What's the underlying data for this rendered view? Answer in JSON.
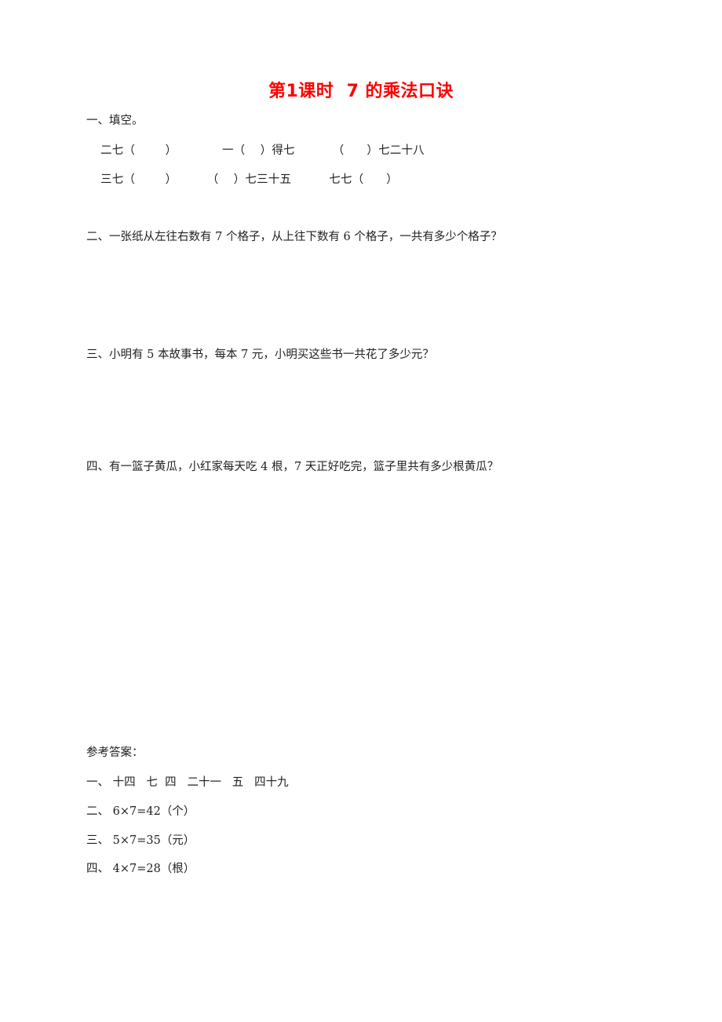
{
  "document": {
    "title": "第1课时  7 的乘法口诀",
    "title_color": "#ff0000"
  },
  "sections": [
    {
      "id": "section-1",
      "heading": "一、填空。",
      "fill_rows": [
        "二七（        ）            一（    ）得七          （      ）七二十八",
        "三七（        ）        （    ）七三十五          七七（      ）"
      ]
    },
    {
      "id": "section-2",
      "text": "二、一张纸从左往右数有 7 个格子，从上往下数有 6 个格子，一共有多少个格子？"
    },
    {
      "id": "section-3",
      "text": "三、小明有 5 本故事书，每本 7 元，小明买这些书一共花了多少元？"
    },
    {
      "id": "section-4",
      "text": "四、有一篮子黄瓜，小红家每天吃 4 根，7 天正好吃完，篮子里共有多少根黄瓜？"
    }
  ],
  "answer_key": {
    "heading": "参考答案：",
    "rows": [
      "一、 十四   七  四   二十一   五   四十九",
      "二、 6×7=42（个）",
      "三、 5×7=35（元）",
      "四、 4×7=28（根）"
    ]
  }
}
